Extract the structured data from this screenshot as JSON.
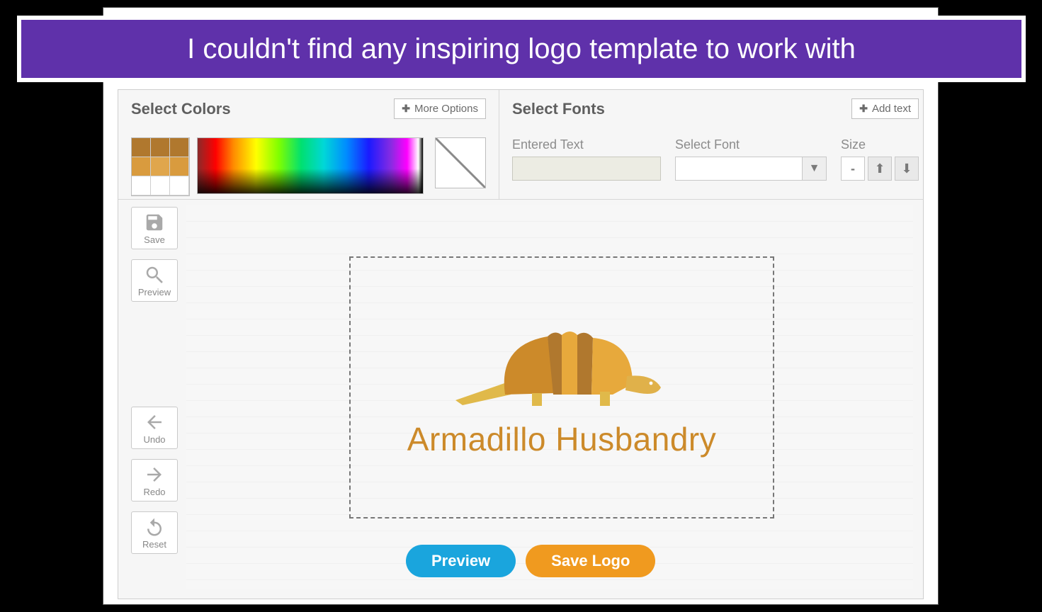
{
  "banner": {
    "text": "I couldn't find any inspiring logo template to work with"
  },
  "colors_panel": {
    "title": "Select Colors",
    "more_options": "More Options"
  },
  "fonts_panel": {
    "title": "Select Fonts",
    "add_text": "Add text",
    "entered_text_label": "Entered Text",
    "entered_text_value": "",
    "select_font_label": "Select Font",
    "select_font_value": "",
    "size_label": "Size",
    "size_value": "-"
  },
  "sidebar": {
    "save": "Save",
    "preview": "Preview",
    "undo": "Undo",
    "redo": "Redo",
    "reset": "Reset"
  },
  "logo": {
    "text": "Armadillo Husbandry",
    "primary_color": "#cc8a2a",
    "secondary_color": "#e7a93c",
    "accent_color": "#e0b94a"
  },
  "actions": {
    "preview": "Preview",
    "save_logo": "Save Logo"
  }
}
